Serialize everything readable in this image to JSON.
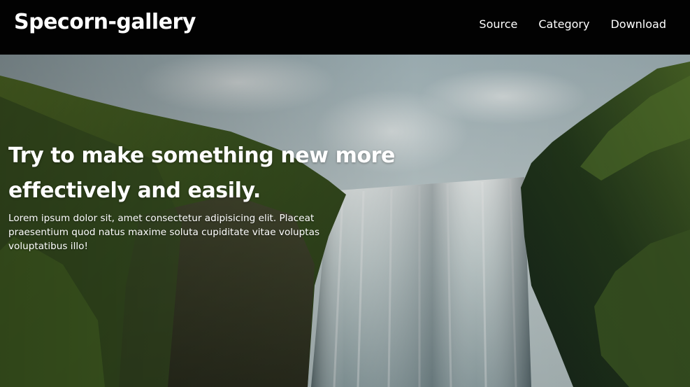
{
  "navbar": {
    "logo": "Specorn-gallery",
    "links": [
      "Source",
      "Category",
      "Download"
    ]
  },
  "hero": {
    "heading": "Try to make something new more effectively and easily.",
    "paragraph": "Lorem ipsum dolor sit, amet consectetur adipisicing elit. Placeat praesentium quod natus maxime soluta cupiditate vitae voluptas voluptatibus illo!"
  },
  "colors": {
    "navbar_background": "#020202",
    "text": "#ffffff"
  }
}
